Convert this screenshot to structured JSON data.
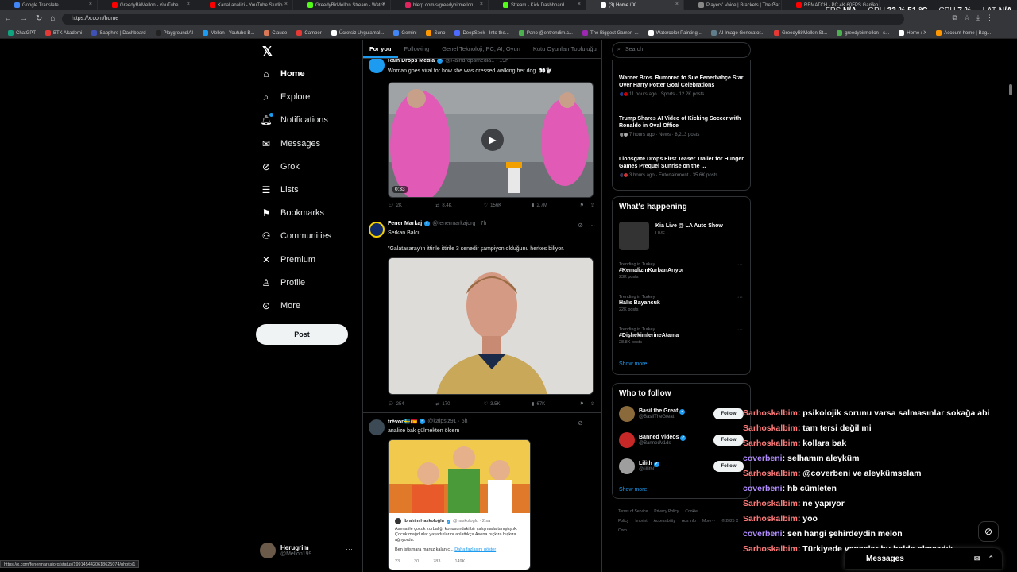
{
  "browser": {
    "tabs": [
      {
        "label": "Google Translate",
        "color": "#4285f4"
      },
      {
        "label": "GreedyBirMellon - YouTube",
        "color": "#ff0000"
      },
      {
        "label": "Kanal analizi - YouTube Studio",
        "color": "#ff0000"
      },
      {
        "label": "GreedyBirMellon Stream - Watch",
        "color": "#53fc18"
      },
      {
        "label": "blerp.com/s/greedybirmellon",
        "color": "#e0245e"
      },
      {
        "label": "Stream - Kick Dashboard",
        "color": "#53fc18"
      },
      {
        "label": "(3) Home / X",
        "color": "#ffffff",
        "active": true
      },
      {
        "label": "Players' Voice | Brackets | The Gar",
        "color": "#888888"
      },
      {
        "label": "REMATCH - PC 4K 60FPS Gamep",
        "color": "#ff0000"
      }
    ],
    "url": "https://x.com/home",
    "stats": {
      "fps_label": "FPS",
      "fps": "N/A",
      "gpu_label": "GPU",
      "gpu": "33 % 51 °C",
      "cpu_label": "CPU",
      "cpu": "7 %",
      "lat_label": "LAT",
      "lat": "N/A"
    },
    "bookmarks": [
      {
        "label": "ChatGPT",
        "color": "#10a37f"
      },
      {
        "label": "BTK Akademi",
        "color": "#e53935"
      },
      {
        "label": "Sapphire | Dashboard",
        "color": "#3f51b5"
      },
      {
        "label": "Playground AI",
        "color": "#222222"
      },
      {
        "label": "Mellon - Youtube B...",
        "color": "#1d9bf0"
      },
      {
        "label": "Claude",
        "color": "#d97757"
      },
      {
        "label": "Camper",
        "color": "#e53935"
      },
      {
        "label": "Ücretsiz Uygulamal...",
        "color": "#ffffff"
      },
      {
        "label": "Gemini",
        "color": "#4285f4"
      },
      {
        "label": "Suno",
        "color": "#ff9800"
      },
      {
        "label": "DeepSeek - Into the...",
        "color": "#4d6bfe"
      },
      {
        "label": "Pano @entrendim.c...",
        "color": "#4caf50"
      },
      {
        "label": "The Biggest Gamer -...",
        "color": "#9c27b0"
      },
      {
        "label": "Watercolor Painting...",
        "color": "#ffffff"
      },
      {
        "label": "AI Image Generator...",
        "color": "#607d8b"
      },
      {
        "label": "GreedyBirMellon St...",
        "color": "#e53935"
      },
      {
        "label": "greedybirmellon - s...",
        "color": "#4caf50"
      },
      {
        "label": "Home / X",
        "color": "#ffffff"
      },
      {
        "label": "Account home | Bag...",
        "color": "#ff9800"
      }
    ],
    "status_url": "https://x.com/fenermarkajorg/status/1991454420618625074/photo/1"
  },
  "nav": {
    "items": [
      {
        "label": "Home",
        "icon": "home-icon",
        "glyph": "⌂"
      },
      {
        "label": "Explore",
        "icon": "search-icon",
        "glyph": "⌕"
      },
      {
        "label": "Notifications",
        "icon": "bell-icon",
        "glyph": "🔔︎"
      },
      {
        "label": "Messages",
        "icon": "mail-icon",
        "glyph": "✉"
      },
      {
        "label": "Grok",
        "icon": "grok-icon",
        "glyph": "⊘"
      },
      {
        "label": "Lists",
        "icon": "list-icon",
        "glyph": "☰"
      },
      {
        "label": "Bookmarks",
        "icon": "bookmark-icon",
        "glyph": "⚑"
      },
      {
        "label": "Communities",
        "icon": "people-icon",
        "glyph": "⚇"
      },
      {
        "label": "Premium",
        "icon": "x-icon",
        "glyph": "✕"
      },
      {
        "label": "Profile",
        "icon": "person-icon",
        "glyph": "♙"
      },
      {
        "label": "More",
        "icon": "more-circle-icon",
        "glyph": "⊙"
      }
    ],
    "post_label": "Post",
    "user": {
      "name": "Herugrim",
      "handle": "@Mellon199"
    }
  },
  "feed": {
    "tabs": [
      "For you",
      "Following",
      "Genel Teknoloji, PC, AI, Oyun",
      "Kutu Oyunları Topluluğu"
    ],
    "posts": [
      {
        "name": "Rain Drops Media",
        "handle": "@Raindropsmedia1 · 19h",
        "text": "Woman goes viral for how she was dressed walking her dog. 👀🐩",
        "video_time": "0:33",
        "replies": "2K",
        "reposts": "8.4K",
        "likes": "156K",
        "views": "2.7M"
      },
      {
        "name": "Fener Markaj",
        "handle": "@fenermarkajorg · 7h",
        "text1": "Serkan Balcı:",
        "text2": "\"Galatasaray'ın ittirile ittirile 3 senedir şampiyon olduğunu herkes biliyor.",
        "replies": "254",
        "reposts": "170",
        "likes": "3.5K",
        "views": "67K"
      },
      {
        "name": "trévor🇸🇪🇪🇸",
        "handle": "@kalpsiz91 · 5h",
        "text": "analize bak gülmekten ölcem",
        "quote_name": "İbrahim Haskoloğlu",
        "quote_handle": "@haskologlu · 2 sa",
        "quote_text": "Asena ile çocuk zorbalığı konusundaki bir çalışmada tanıştıştık. Çocuk mağdurlar yaşadıklarını anlattıkça Asena hıçkıra hıçkıra ağlıyordu.",
        "quote_text2": "Ben istismara maruz kalan ç...",
        "quote_more": "Daha fazlasını göster",
        "quote_counts": [
          "23",
          "30",
          "783",
          "149K"
        ]
      }
    ]
  },
  "right": {
    "search_placeholder": "Search",
    "news": [
      {
        "title": "Warner Bros. Rumored to Sue Fenerbahçe Star Over Harry Potter Goal Celebrations",
        "meta": "11 hours ago · Sports · 12.2K posts"
      },
      {
        "title": "Trump Shares AI Video of Kicking Soccer with Ronaldo in Oval Office",
        "meta": "7 hours ago · News · 8,213 posts"
      },
      {
        "title": "Lionsgate Drops First Teaser Trailer for Hunger Games Prequel Sunrise on the ...",
        "meta": "3 hours ago · Entertainment · 35.6K posts"
      }
    ],
    "happening_title": "What's happening",
    "live": {
      "title": "Kia Live @ LA Auto Show",
      "tag": "LIVE"
    },
    "trends": [
      {
        "cat": "Trending in Turkey",
        "name": "#KemalizmKurbanArıyor",
        "posts": "23K posts"
      },
      {
        "cat": "Trending in Turkey",
        "name": "Halis Bayancuk",
        "posts": "22K posts"
      },
      {
        "cat": "Trending in Turkey",
        "name": "#DişhekimlerineAtama",
        "posts": "28.8K posts"
      }
    ],
    "show_more": "Show more",
    "who_title": "Who to follow",
    "who": [
      {
        "name": "Basil the Great",
        "handle": "@BasilTheGreat",
        "color": "#8a6a3a"
      },
      {
        "name": "Banned Videos",
        "handle": "@BannedV1ds",
        "color": "#c62828"
      },
      {
        "name": "Lilith",
        "handle": "@lillith0",
        "color": "#9e9e9e"
      }
    ],
    "follow_label": "Follow",
    "footer": [
      "Terms of Service",
      "Privacy Policy",
      "Cookie Policy",
      "Imprint",
      "Accessibility",
      "Ads info",
      "More···",
      "© 2025 X Corp."
    ]
  },
  "chat": [
    {
      "user": "Sarhoskalbim",
      "msg": ": psikolojik sorunu varsa salmasınlar sokağa abi",
      "purple": false
    },
    {
      "user": "Sarhoskalbim",
      "msg": ": tam tersi değil mi",
      "purple": false
    },
    {
      "user": "Sarhoskalbim",
      "msg": ": kollara bak",
      "purple": false
    },
    {
      "user": "coverbeni",
      "msg": ": selhamın aleyküm",
      "purple": true
    },
    {
      "user": "Sarhoskalbim",
      "msg": ": @coverbeni ve aleykümselam",
      "purple": false
    },
    {
      "user": "coverbeni",
      "msg": ": hb cümleten",
      "purple": true
    },
    {
      "user": "Sarhoskalbim",
      "msg": ": ne yapıyor",
      "purple": false
    },
    {
      "user": "Sarhoskalbim",
      "msg": ": yoo",
      "purple": false
    },
    {
      "user": "coverbeni",
      "msg": ": sen hangi şehirdeydin melon",
      "purple": true
    },
    {
      "user": "Sarhoskalbim",
      "msg": ": Türkiyede yapsalar bu halde olmazdık",
      "purple": false
    }
  ],
  "messages_bar": "Messages"
}
